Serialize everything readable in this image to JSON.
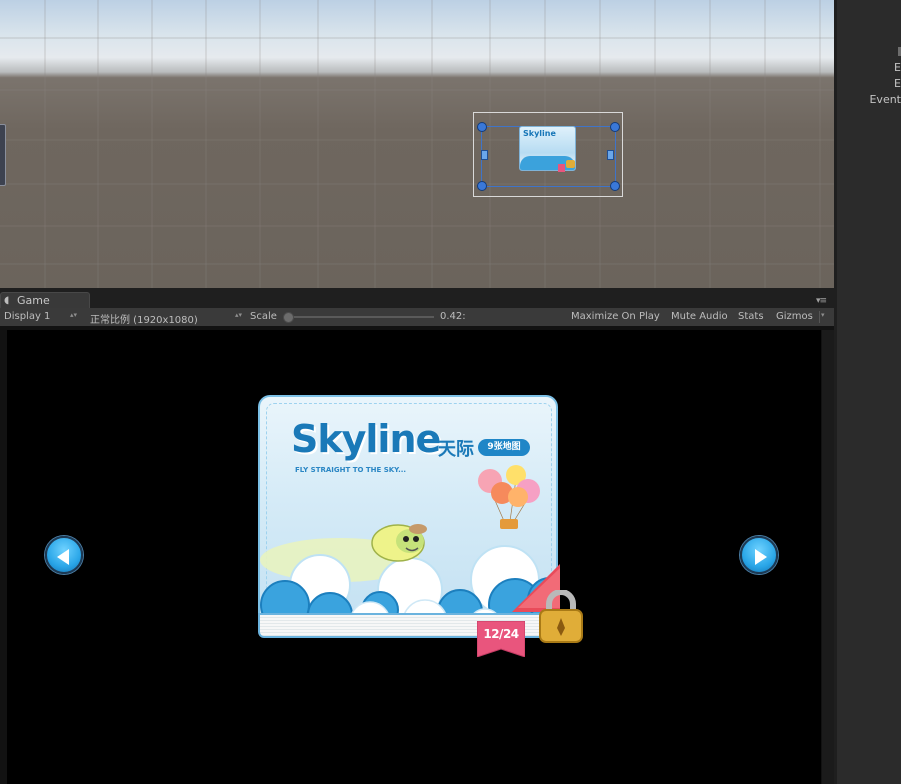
{
  "scene": {
    "thumbnail_label": "Skyline"
  },
  "hierarchy_panel": {
    "items": [
      "E",
      "E",
      "Event"
    ]
  },
  "game_tab": {
    "label": "Game",
    "icon": "pacman-icon"
  },
  "toolbar": {
    "display": "Display 1",
    "aspect": "正常比例 (1920x1080)",
    "scale_label": "Scale",
    "scale_value": "0.42:",
    "maximize_on_play": "Maximize On Play",
    "mute_audio": "Mute Audio",
    "stats": "Stats",
    "gizmos": "Gizmos"
  },
  "level_card": {
    "title": "Skyline",
    "title_cn": "天际",
    "badge": "9张地图",
    "subtitle": "FLY STRAIGHT TO THE SKY...",
    "progress": "12/24",
    "locked": true
  },
  "colors": {
    "accent_blue": "#1a79b8",
    "button_blue": "#2aa6e8",
    "ribbon_pink": "#e9557d",
    "lock_gold": "#e0ad38"
  }
}
